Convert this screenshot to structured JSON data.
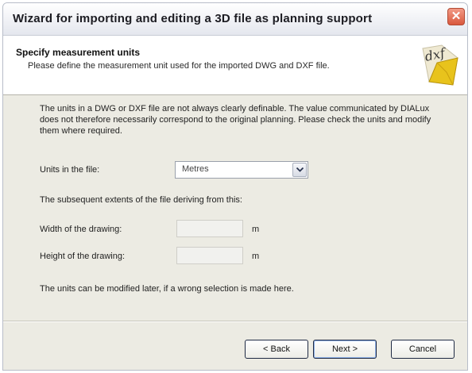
{
  "window": {
    "title": "Wizard for importing and editing a 3D file as planning support",
    "close_glyph": "✕"
  },
  "header": {
    "title": "Specify measurement units",
    "description": "Please define the measurement unit used for the imported DWG and DXF file.",
    "logo_text": "dxf",
    "logo_icon": "dxf-file-icon"
  },
  "content": {
    "info_text": "The units in a DWG or DXF file are not always clearly definable. The value communicated by DIALux does not therefore necessarily correspond to the original planning. Please check the units and modify them where required.",
    "units_label": "Units in the file:",
    "units_selected": "Metres",
    "extents_label": "The subsequent extents of the file deriving from this:",
    "width_label": "Width of the drawing:",
    "width_value": "",
    "width_unit": "m",
    "height_label": "Height of the drawing:",
    "height_value": "",
    "height_unit": "m",
    "note": "The units can be modified later, if a wrong selection is made here."
  },
  "buttons": {
    "back": "< Back",
    "next": "Next >",
    "cancel": "Cancel"
  },
  "colors": {
    "dialog_bg": "#ecebe3",
    "header_bg": "#ffffff",
    "close_button": "#d9583d",
    "logo_yellow": "#e8c31c"
  }
}
